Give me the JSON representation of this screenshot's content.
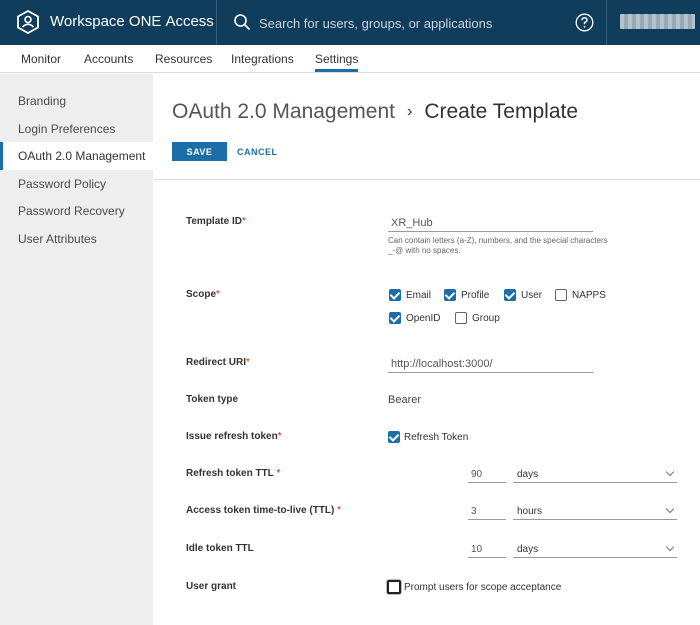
{
  "header": {
    "app_name": "Workspace ONE",
    "app_product": "Access",
    "search_placeholder": "Search for users, groups, or applications",
    "help_icon": "help-circle-icon",
    "logo_icon": "workspace-one-hexagon-icon"
  },
  "nav": {
    "tabs": [
      {
        "label": "Monitor"
      },
      {
        "label": "Accounts"
      },
      {
        "label": "Resources"
      },
      {
        "label": "Integrations"
      },
      {
        "label": "Settings"
      }
    ],
    "active": "Settings"
  },
  "sidebar": {
    "items": [
      {
        "label": "Branding"
      },
      {
        "label": "Login Preferences"
      },
      {
        "label": "OAuth 2.0 Management"
      },
      {
        "label": "Password Policy"
      },
      {
        "label": "Password Recovery"
      },
      {
        "label": "User Attributes"
      }
    ],
    "active": "OAuth 2.0 Management"
  },
  "breadcrumb": {
    "parent": "OAuth 2.0 Management",
    "separator": "›",
    "current": "Create Template"
  },
  "actions": {
    "save": "SAVE",
    "cancel": "CANCEL"
  },
  "form": {
    "template_id": {
      "label": "Template ID",
      "required": "*",
      "value": "XR_Hub",
      "hint": "Can contain letters (a-Z), numbers, and the special characters _-@ with no spaces."
    },
    "scope": {
      "label": "Scope",
      "required": "*",
      "options": [
        {
          "label": "Email",
          "checked": true
        },
        {
          "label": "Profile",
          "checked": true
        },
        {
          "label": "User",
          "checked": true
        },
        {
          "label": "NAPPS",
          "checked": false
        },
        {
          "label": "OpenID",
          "checked": true
        },
        {
          "label": "Group",
          "checked": false
        }
      ]
    },
    "redirect_uri": {
      "label": "Redirect URI",
      "required": "*",
      "value": "http://localhost:3000/"
    },
    "token_type": {
      "label": "Token type",
      "value": "Bearer"
    },
    "issue_refresh_token": {
      "label": "Issue refresh token",
      "required": "*",
      "option_label": "Refresh Token",
      "checked": true
    },
    "refresh_token_ttl": {
      "label": "Refresh token TTL",
      "required": "*",
      "value": "90",
      "unit": "days"
    },
    "access_token_ttl": {
      "label": "Access token time-to-live (TTL)",
      "required": "*",
      "value": "3",
      "unit": "hours"
    },
    "idle_token_ttl": {
      "label": "Idle token TTL",
      "value": "10",
      "unit": "days"
    },
    "user_grant": {
      "label": "User grant",
      "option_label": "Prompt users for scope acceptance",
      "checked": false
    }
  },
  "colors": {
    "header_bg": "#0f3d5b",
    "accent": "#1b6ea8",
    "sidebar_bg": "#eeeeee",
    "required": "#c92100"
  }
}
